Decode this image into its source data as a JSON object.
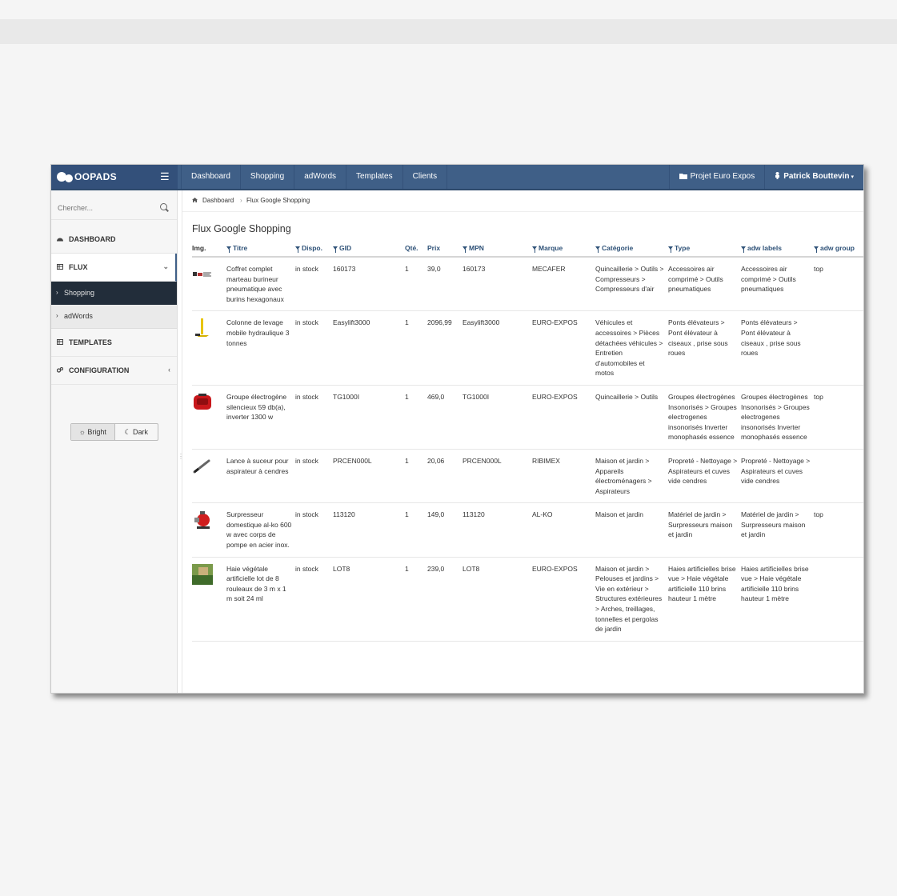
{
  "navbar": {
    "brand": "OOPADS",
    "links": [
      "Dashboard",
      "Shopping",
      "adWords",
      "Templates",
      "Clients"
    ],
    "project": "Projet Euro Expos",
    "user": "Patrick Bouttevin"
  },
  "sidebar": {
    "search_placeholder": "Chercher...",
    "items": {
      "dashboard": "DASHBOARD",
      "flux": "FLUX",
      "shopping": "Shopping",
      "adwords": "adWords",
      "templates": "TEMPLATES",
      "configuration": "CONFIGURATION"
    },
    "theme": {
      "bright": "Bright",
      "dark": "Dark"
    }
  },
  "breadcrumb": {
    "home": "Dashboard",
    "current": "Flux Google Shopping"
  },
  "page_title": "Flux Google Shopping",
  "table": {
    "headers": [
      "Img.",
      "Titre",
      "Dispo.",
      "GID",
      "Qté.",
      "Prix",
      "MPN",
      "Marque",
      "Catégorie",
      "Type",
      "adw labels",
      "adw group"
    ],
    "rows": [
      {
        "titre": "Coffret complet marteau burineur pneumatique avec burins hexagonaux",
        "dispo": "in stock",
        "gid": "160173",
        "qte": "1",
        "prix": "39,0",
        "mpn": "160173",
        "marque": "MECAFER",
        "categorie": "Quincaillerie > Outils > Compresseurs > Compresseurs d'air",
        "type": "Accessoires air comprimé > Outils pneumatiques",
        "labels": "Accessoires air comprimé > Outils pneumatiques",
        "group": "top",
        "thumb": "tools-kit-icon"
      },
      {
        "titre": "Colonne de levage mobile hydraulique 3 tonnes",
        "dispo": "in stock",
        "gid": "Easylift3000",
        "qte": "1",
        "prix": "2096,99",
        "mpn": "Easylift3000",
        "marque": "EURO-EXPOS",
        "categorie": "Véhicules et accessoires > Pièces détachées véhicules > Entretien d'automobiles et motos",
        "type": "Ponts élévateurs > Pont élévateur à ciseaux , prise sous roues",
        "labels": "Ponts élévateurs > Pont élévateur à ciseaux , prise sous roues",
        "group": "",
        "thumb": "lift-icon"
      },
      {
        "titre": "Groupe électrogène silencieux 59 db(a), inverter 1300 w",
        "dispo": "in stock",
        "gid": "TG1000I",
        "qte": "1",
        "prix": "469,0",
        "mpn": "TG1000I",
        "marque": "EURO-EXPOS",
        "categorie": "Quincaillerie > Outils",
        "type": "Groupes électrogènes Insonorisés > Groupes electrogenes insonorisés Inverter monophasés essence",
        "labels": "Groupes électrogènes Insonorisés > Groupes electrogenes insonorisés Inverter monophasés essence",
        "group": "top",
        "thumb": "generator-icon"
      },
      {
        "titre": "Lance à suceur pour aspirateur à cendres",
        "dispo": "in stock",
        "gid": "PRCEN000L",
        "qte": "1",
        "prix": "20,06",
        "mpn": "PRCEN000L",
        "marque": "RIBIMEX",
        "categorie": "Maison et jardin > Appareils électroménagers > Aspirateurs",
        "type": "Propreté - Nettoyage > Aspirateurs et cuves vide cendres",
        "labels": "Propreté - Nettoyage > Aspirateurs et cuves vide cendres",
        "group": "",
        "thumb": "nozzle-icon"
      },
      {
        "titre": "Surpresseur domestique al-ko 600 w avec corps de pompe en acier inox.",
        "dispo": "in stock",
        "gid": "113120",
        "qte": "1",
        "prix": "149,0",
        "mpn": "113120",
        "marque": "AL-KO",
        "categorie": "Maison et jardin",
        "type": "Matériel de jardin > Surpresseurs maison et jardin",
        "labels": "Matériel de jardin > Surpresseurs maison et jardin",
        "group": "top",
        "thumb": "pump-icon"
      },
      {
        "titre": "Haie végétale artificielle lot de 8 rouleaux de 3 m x 1 m soit 24 ml",
        "dispo": "in stock",
        "gid": "LOT8",
        "qte": "1",
        "prix": "239,0",
        "mpn": "LOT8",
        "marque": "EURO-EXPOS",
        "categorie": "Maison et jardin > Pelouses et jardins > Vie en extérieur > Structures extérieures > Arches, treillages, tonnelles et pergolas de jardin",
        "type": "Haies artificielles brise vue > Haie végétale artificielle 110 brins hauteur 1 mètre",
        "labels": "Haies artificielles brise vue > Haie végétale artificielle 110 brins hauteur 1 mètre",
        "group": "",
        "thumb": "hedge-icon"
      }
    ]
  },
  "colors": {
    "navbar": "#3f5f87",
    "sidebar_active": "#222d3a",
    "header_text": "#2f5278"
  }
}
